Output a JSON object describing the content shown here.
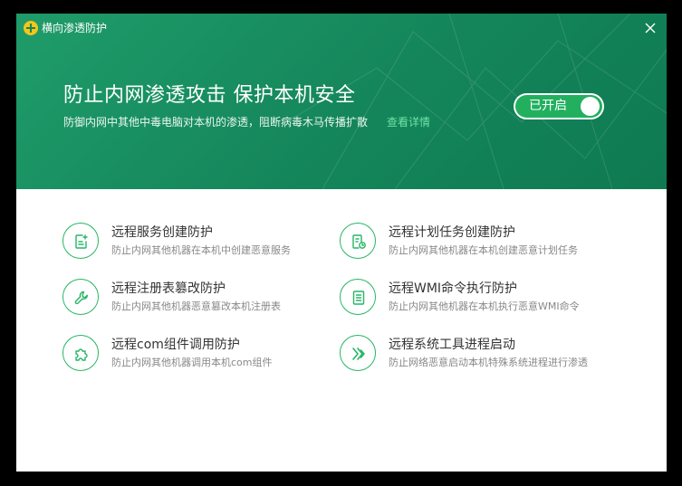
{
  "window": {
    "title": "横向渗透防护"
  },
  "header": {
    "title": "防止内网渗透攻击 保护本机安全",
    "description": "防御内网中其他中毒电脑对本机的渗透，阻断病毒木马传播扩散",
    "detail_link": "查看详情",
    "toggle": {
      "label": "已开启",
      "state": "on"
    }
  },
  "features": [
    {
      "title": "远程服务创建防护",
      "desc": "防止内网其他机器在本机中创建恶意服务",
      "icon": "file-edit-icon"
    },
    {
      "title": "远程计划任务创建防护",
      "desc": "防止内网其他机器在本机创建恶意计划任务",
      "icon": "schedule-icon"
    },
    {
      "title": "远程注册表篡改防护",
      "desc": "防止内网其他机器恶意篡改本机注册表",
      "icon": "wrench-icon"
    },
    {
      "title": "远程WMI命令执行防护",
      "desc": "防止内网其他机器在本机执行恶意WMI命令",
      "icon": "document-lines-icon"
    },
    {
      "title": "远程com组件调用防护",
      "desc": "防止内网其他机器调用本机com组件",
      "icon": "puzzle-icon"
    },
    {
      "title": "远程系统工具进程启动",
      "desc": "防止网络恶意启动本机特殊系统进程进行渗透",
      "icon": "double-chevron-icon"
    }
  ],
  "colors": {
    "header_green": "#14855a",
    "accent_green": "#22b05f",
    "link_green": "#6fe3a8",
    "icon_green": "#27b566"
  }
}
